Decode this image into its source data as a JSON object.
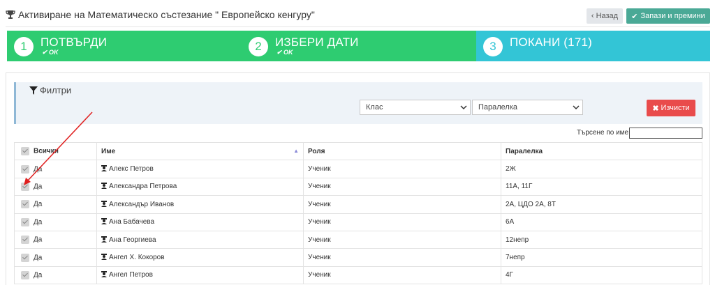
{
  "header": {
    "title": "Активиране на Математическо състезание \" Европейско кенгуру\"",
    "back_label": "Назад",
    "save_label": "Запази и премини"
  },
  "wizard": {
    "steps": [
      {
        "number": "1",
        "label": "ПОТВЪРДИ",
        "status": "OK"
      },
      {
        "number": "2",
        "label": "ИЗБЕРИ ДАТИ",
        "status": "OK"
      },
      {
        "number": "3",
        "label": "ПОКАНИ (171)",
        "status": ""
      }
    ]
  },
  "filters": {
    "title": "Филтри",
    "class_select": "Клас",
    "section_select": "Паралелка",
    "clear_label": "Изчисти"
  },
  "search": {
    "label": "Търсене по име:",
    "value": ""
  },
  "table": {
    "headers": {
      "select": "Всички",
      "name": "Име",
      "role": "Роля",
      "section": "Паралелка"
    },
    "rows": [
      {
        "select": "Да",
        "name": "Алекс Петров",
        "role": "Ученик",
        "section": "2Ж"
      },
      {
        "select": "Да",
        "name": "Александра Петрова",
        "role": "Ученик",
        "section": "11А, 11Г"
      },
      {
        "select": "Да",
        "name": "Александър Иванов",
        "role": "Ученик",
        "section": "2А, ЦДО 2А, 8Т"
      },
      {
        "select": "Да",
        "name": "Ана Бабачева",
        "role": "Ученик",
        "section": "6А"
      },
      {
        "select": "Да",
        "name": "Ана Георгиева",
        "role": "Ученик",
        "section": "12непр"
      },
      {
        "select": "Да",
        "name": "Ангел Х. Кокоров",
        "role": "Ученик",
        "section": "7непр"
      },
      {
        "select": "Да",
        "name": "Ангел Петров",
        "role": "Ученик",
        "section": "4Г"
      }
    ]
  },
  "colors": {
    "step_done": "#2ecc71",
    "step_active": "#33c5d6",
    "save_button": "#4aa996",
    "clear_button": "#e94b4b",
    "annotation_arrow": "#e02020"
  }
}
